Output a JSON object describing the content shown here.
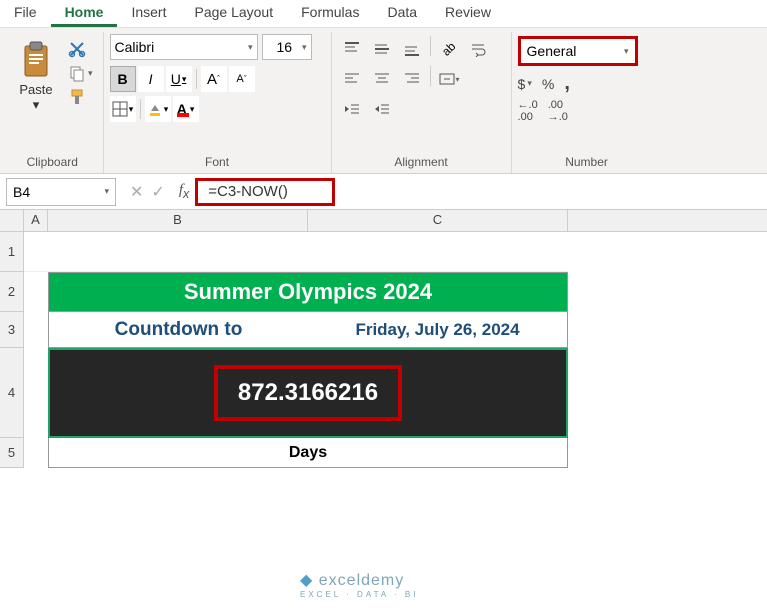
{
  "menu": {
    "file": "File",
    "home": "Home",
    "insert": "Insert",
    "pagelayout": "Page Layout",
    "formulas": "Formulas",
    "data": "Data",
    "review": "Review"
  },
  "ribbon": {
    "clipboard": {
      "paste": "Paste",
      "label": "Clipboard"
    },
    "font": {
      "name": "Calibri",
      "size": "16",
      "bold": "B",
      "italic": "I",
      "underline": "U",
      "label": "Font",
      "growA": "A",
      "shrinkA": "A"
    },
    "alignment": {
      "label": "Alignment"
    },
    "number": {
      "format": "General",
      "currency": "$",
      "percent": "%",
      "comma": ",",
      "dec_inc": ".0",
      "dec_dec": ".00",
      "label": "Number"
    }
  },
  "formulabar": {
    "cell_ref": "B4",
    "formula": "=C3-NOW()"
  },
  "columns": {
    "corner": "",
    "A": "A",
    "B": "B",
    "C": "C"
  },
  "rows": {
    "r1": "1",
    "r2": "2",
    "r3": "3",
    "r4": "4",
    "r5": "5"
  },
  "content": {
    "title": "Summer Olympics 2024",
    "countdown_label": "Countdown to",
    "target_date": "Friday, July 26, 2024",
    "value": "872.3166216",
    "unit": "Days"
  },
  "watermark": {
    "brand": "exceldemy",
    "tag": "EXCEL · DATA · BI"
  }
}
